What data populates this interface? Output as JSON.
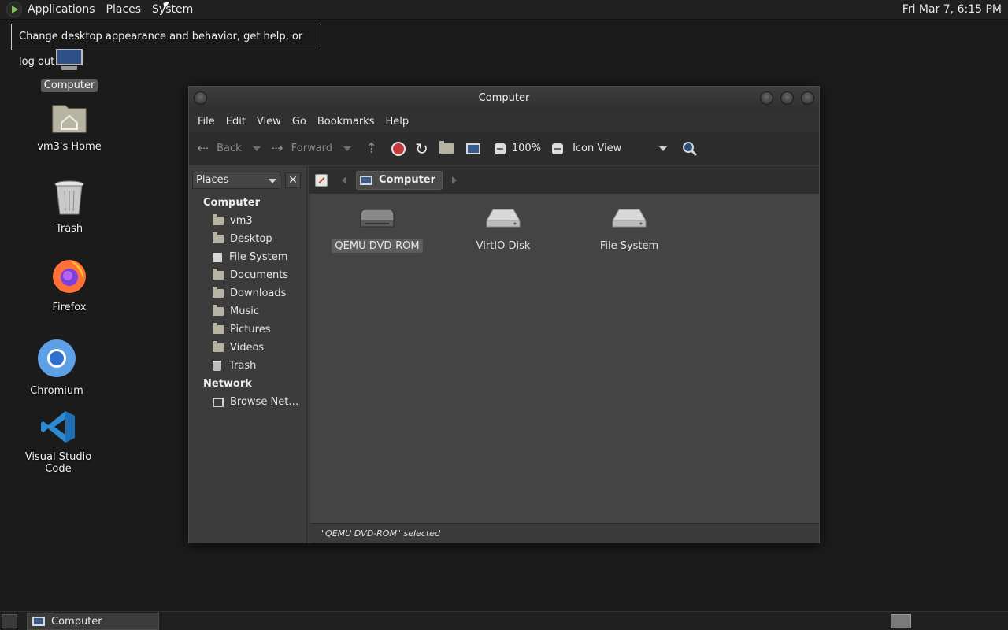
{
  "top_panel": {
    "menus": [
      "Applications",
      "Places",
      "System"
    ],
    "clock": "Fri Mar  7,  6:15 PM"
  },
  "tooltip": "Change desktop appearance and behavior, get help, or log out",
  "desktop": {
    "icons": [
      "Computer",
      "vm3's Home",
      "Trash",
      "Firefox",
      "Chromium",
      "Visual Studio Code"
    ]
  },
  "window": {
    "title": "Computer",
    "menubar": [
      "File",
      "Edit",
      "View",
      "Go",
      "Bookmarks",
      "Help"
    ],
    "toolbar": {
      "back": "Back",
      "forward": "Forward",
      "zoom": "100%",
      "view_mode": "Icon View"
    },
    "sidebar": {
      "combo": "Places",
      "sections": [
        {
          "heading": "Computer",
          "items": [
            "vm3",
            "Desktop",
            "File System",
            "Documents",
            "Downloads",
            "Music",
            "Pictures",
            "Videos",
            "Trash"
          ]
        },
        {
          "heading": "Network",
          "items": [
            "Browse Net…"
          ]
        }
      ]
    },
    "pathbar": {
      "current": "Computer"
    },
    "files": [
      "QEMU DVD-ROM",
      "VirtIO Disk",
      "File System"
    ],
    "status": "\"QEMU DVD-ROM\" selected"
  },
  "taskbar": {
    "task": "Computer"
  }
}
